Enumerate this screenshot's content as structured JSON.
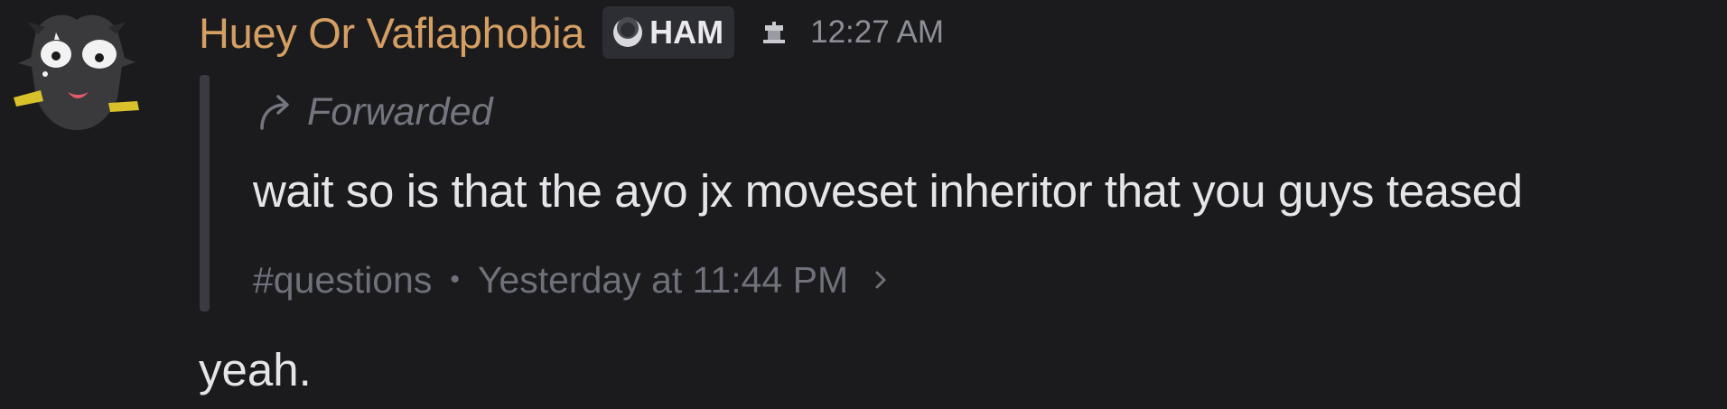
{
  "message": {
    "author": {
      "username": "Huey Or Vaflaphobia",
      "username_color": "#d59f63",
      "tag": {
        "icon": "moon-icon",
        "label": "HAM"
      },
      "extra_icon": "bot-icon"
    },
    "timestamp": "12:27 AM",
    "forward": {
      "label": "Forwarded",
      "text": "wait so is that the ayo jx moveset inheritor that you guys teased",
      "channel": "#questions",
      "separator": "•",
      "time": "Yesterday at 11:44 PM"
    },
    "reply": "yeah."
  }
}
